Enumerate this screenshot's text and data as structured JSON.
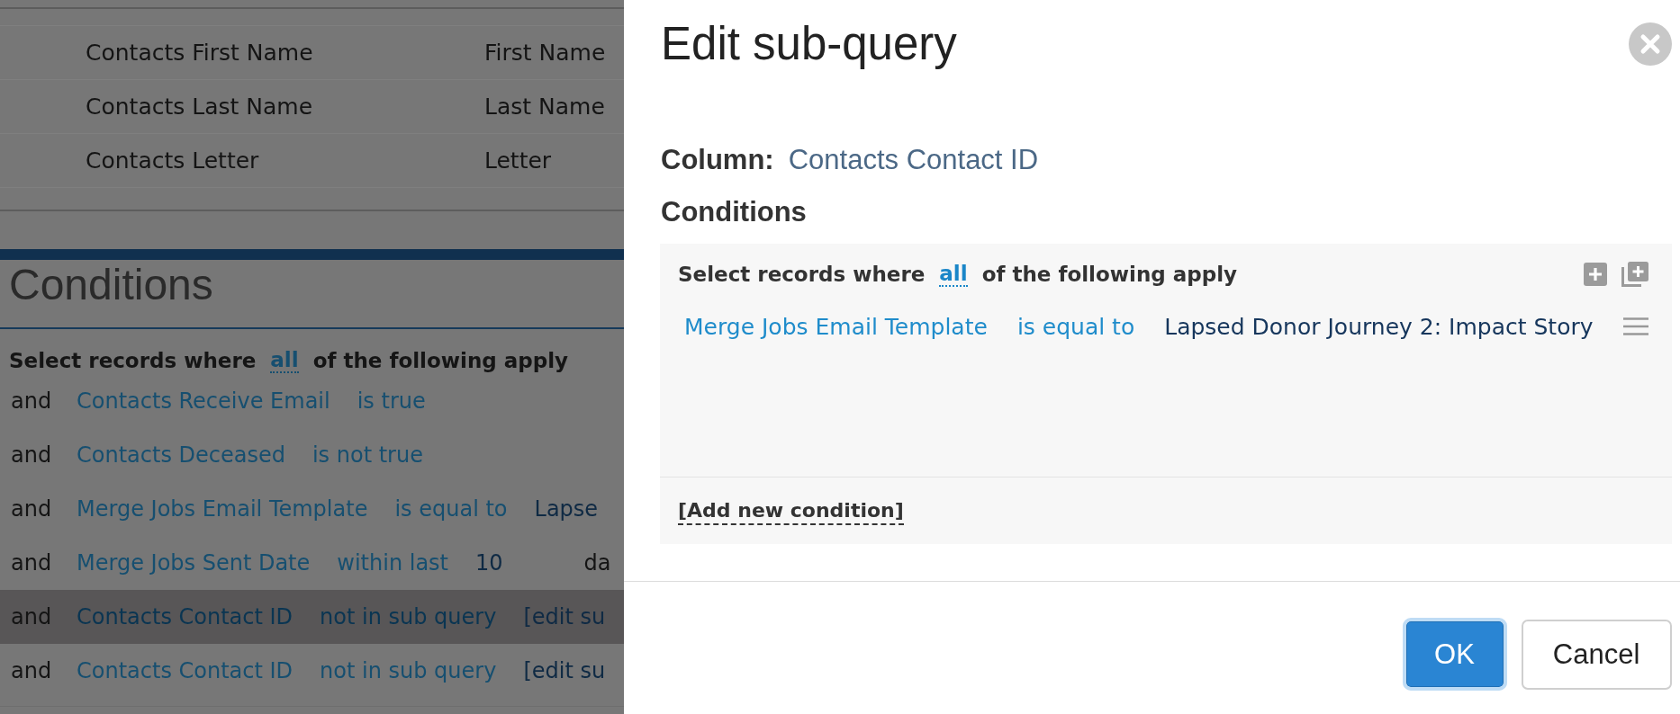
{
  "background": {
    "table": {
      "rows": [
        {
          "cells": [
            "Contacts First Name",
            "First Name"
          ]
        },
        {
          "cells": [
            "Contacts Last Name",
            "Last Name"
          ]
        },
        {
          "cells": [
            "Contacts Letter",
            "Letter"
          ]
        }
      ]
    },
    "conditions": {
      "title": "Conditions",
      "intro": {
        "prefix": "Select records where",
        "match": "all",
        "suffix": "of the following apply"
      },
      "rows": [
        {
          "conjunction": "and",
          "field": "Contacts Receive Email",
          "operator": "is true",
          "highlighted": false
        },
        {
          "conjunction": "and",
          "field": "Contacts Deceased",
          "operator": "is not true",
          "highlighted": false
        },
        {
          "conjunction": "and",
          "field": "Merge Jobs Email Template",
          "operator": "is equal to",
          "value": "Lapse",
          "highlighted": false
        },
        {
          "conjunction": "and",
          "field": "Merge Jobs Sent Date",
          "operator": "within last",
          "value": "10",
          "unit": "da",
          "highlighted": false
        },
        {
          "conjunction": "and",
          "field": "Contacts Contact ID",
          "operator": "not in sub query",
          "value": "[edit su",
          "highlighted": true
        },
        {
          "conjunction": "and",
          "field": "Contacts Contact ID",
          "operator": "not in sub query",
          "value": "[edit su",
          "highlighted": false
        }
      ]
    }
  },
  "dialog": {
    "title": "Edit sub-query",
    "column": {
      "label": "Column:",
      "value": "Contacts Contact ID"
    },
    "conditions_heading": "Conditions",
    "intro": {
      "prefix": "Select records where",
      "match": "all",
      "suffix": "of the following apply"
    },
    "conditions": [
      {
        "field": "Merge Jobs Email Template",
        "operator": "is equal to",
        "value": "Lapsed Donor Journey 2: Impact Story"
      }
    ],
    "add_condition": "[Add new condition]",
    "buttons": [
      {
        "label": "OK",
        "kind": "primary",
        "focused": true
      },
      {
        "label": "Cancel",
        "kind": "secondary",
        "focused": false
      }
    ]
  }
}
